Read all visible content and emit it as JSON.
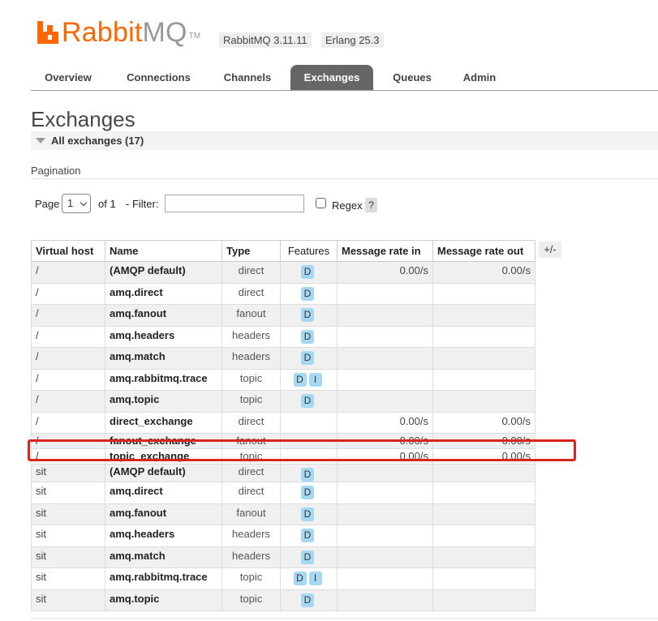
{
  "app": {
    "logo_text_primary": "Rabbit",
    "logo_text_secondary": "MQ",
    "logo_tm": "TM",
    "rabbitmq_version": "RabbitMQ 3.11.11",
    "erlang_version": "Erlang 25.3",
    "brand_color": "#ff6600"
  },
  "nav": {
    "tabs": [
      "Overview",
      "Connections",
      "Channels",
      "Exchanges",
      "Queues",
      "Admin"
    ],
    "active": "Exchanges"
  },
  "page": {
    "title": "Exchanges",
    "section_label": "All exchanges (17)"
  },
  "pagination": {
    "title": "Pagination",
    "page_label": "Page",
    "page_value": "1",
    "of_label": "of 1",
    "filter_label": "- Filter:",
    "filter_value": "",
    "regex_label": "Regex",
    "regex_checked": false,
    "help_label": "?"
  },
  "table": {
    "columns": [
      "Virtual host",
      "Name",
      "Type",
      "Features",
      "Message rate in",
      "Message rate out"
    ],
    "toggle_label": "+/-",
    "rows": [
      {
        "vhost": "/",
        "name": "(AMQP default)",
        "type": "direct",
        "features": [
          "D"
        ],
        "rate_in": "0.00/s",
        "rate_out": "0.00/s"
      },
      {
        "vhost": "/",
        "name": "amq.direct",
        "type": "direct",
        "features": [
          "D"
        ],
        "rate_in": "",
        "rate_out": ""
      },
      {
        "vhost": "/",
        "name": "amq.fanout",
        "type": "fanout",
        "features": [
          "D"
        ],
        "rate_in": "",
        "rate_out": ""
      },
      {
        "vhost": "/",
        "name": "amq.headers",
        "type": "headers",
        "features": [
          "D"
        ],
        "rate_in": "",
        "rate_out": ""
      },
      {
        "vhost": "/",
        "name": "amq.match",
        "type": "headers",
        "features": [
          "D"
        ],
        "rate_in": "",
        "rate_out": ""
      },
      {
        "vhost": "/",
        "name": "amq.rabbitmq.trace",
        "type": "topic",
        "features": [
          "D",
          "I"
        ],
        "rate_in": "",
        "rate_out": ""
      },
      {
        "vhost": "/",
        "name": "amq.topic",
        "type": "topic",
        "features": [
          "D"
        ],
        "rate_in": "",
        "rate_out": ""
      },
      {
        "vhost": "/",
        "name": "direct_exchange",
        "type": "direct",
        "features": [],
        "rate_in": "0.00/s",
        "rate_out": "0.00/s"
      },
      {
        "vhost": "/",
        "name": "fanout_exchange",
        "type": "fanout",
        "features": [],
        "rate_in": "0.00/s",
        "rate_out": "0.00/s"
      },
      {
        "vhost": "/",
        "name": "topic_exchange",
        "type": "topic",
        "features": [],
        "rate_in": "0.00/s",
        "rate_out": "0.00/s"
      },
      {
        "vhost": "sit",
        "name": "(AMQP default)",
        "type": "direct",
        "features": [
          "D"
        ],
        "rate_in": "",
        "rate_out": ""
      },
      {
        "vhost": "sit",
        "name": "amq.direct",
        "type": "direct",
        "features": [
          "D"
        ],
        "rate_in": "",
        "rate_out": ""
      },
      {
        "vhost": "sit",
        "name": "amq.fanout",
        "type": "fanout",
        "features": [
          "D"
        ],
        "rate_in": "",
        "rate_out": ""
      },
      {
        "vhost": "sit",
        "name": "amq.headers",
        "type": "headers",
        "features": [
          "D"
        ],
        "rate_in": "",
        "rate_out": ""
      },
      {
        "vhost": "sit",
        "name": "amq.match",
        "type": "headers",
        "features": [
          "D"
        ],
        "rate_in": "",
        "rate_out": ""
      },
      {
        "vhost": "sit",
        "name": "amq.rabbitmq.trace",
        "type": "topic",
        "features": [
          "D",
          "I"
        ],
        "rate_in": "",
        "rate_out": ""
      },
      {
        "vhost": "sit",
        "name": "amq.topic",
        "type": "topic",
        "features": [
          "D"
        ],
        "rate_in": "",
        "rate_out": ""
      }
    ]
  },
  "annotation": {
    "highlight_color": "#d9261c",
    "highlighted_row": "topic_exchange"
  }
}
